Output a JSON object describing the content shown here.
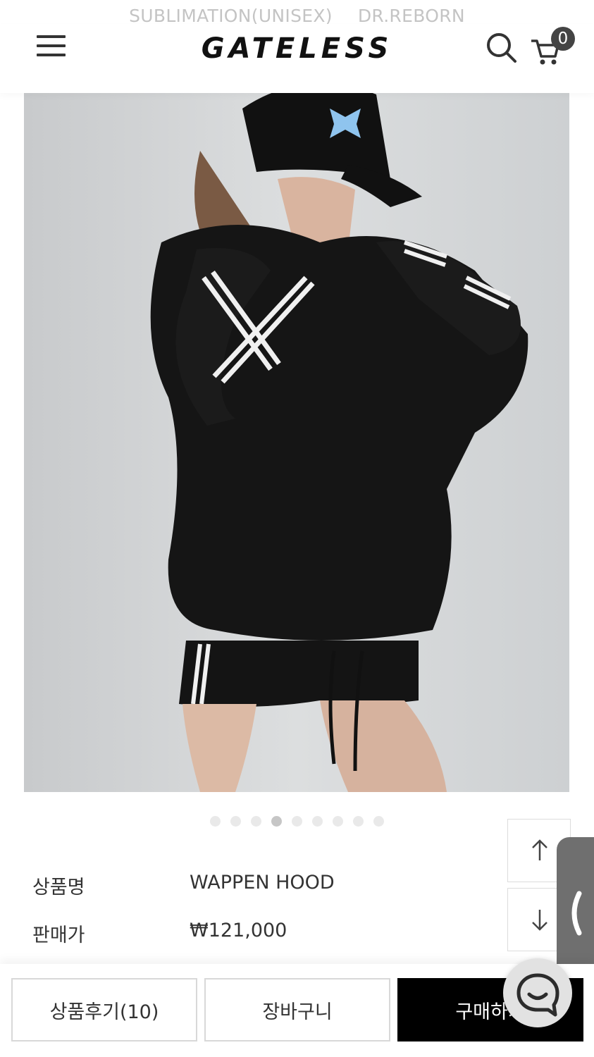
{
  "top_links": [
    "SUBLIMATION(UNISEX)",
    "DR.REBORN"
  ],
  "header": {
    "logo": "GATELESS",
    "cart_count": "0"
  },
  "gallery": {
    "total_images": 9,
    "active_index": 3
  },
  "product": {
    "name_label": "상품명",
    "name": "WAPPEN HOOD",
    "price_label": "판매가",
    "price": "₩121,000"
  },
  "bottom_bar": {
    "review_label": "상품후기(10)",
    "cart_label": "장바구니",
    "buy_label": "구매하기"
  },
  "colors": {
    "accent": "#000000",
    "badge": "#444444",
    "side_tab": "#6f6f6f"
  }
}
